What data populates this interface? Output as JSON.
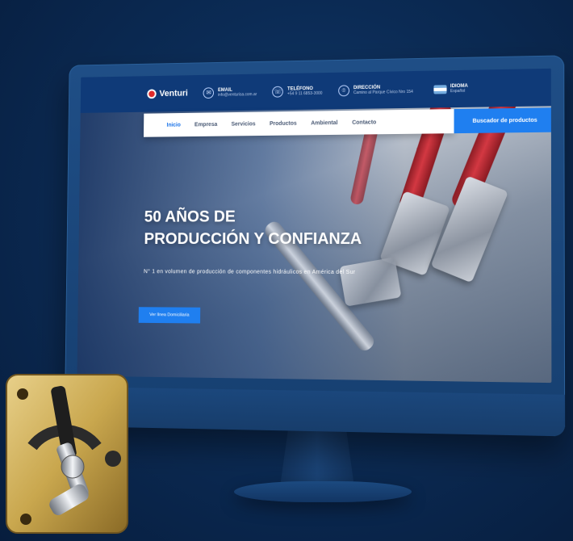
{
  "site": {
    "logo_text": "Venturi",
    "header_info": [
      {
        "label": "EMAIL",
        "value": "info@venturisa.com.ar",
        "icon": "email-icon"
      },
      {
        "label": "TELÉFONO",
        "value": "+54 9 11 6853-3000",
        "icon": "phone-icon"
      },
      {
        "label": "DIRECCIÓN",
        "value": "Camino al Parque Cívico Nro 154",
        "icon": "location-icon"
      }
    ],
    "language": {
      "label": "IDIOMA",
      "value": "Español"
    },
    "nav": [
      "Inicio",
      "Empresa",
      "Servicios",
      "Productos",
      "Ambiental",
      "Contacto"
    ],
    "nav_cta": "Buscador de productos",
    "hero": {
      "title_line1": "50 AÑOS DE",
      "title_line2": "PRODUCCIÓN Y CONFIANZA",
      "subtitle": "N° 1 en volumen de producción de componentes hidráulicos en América del Sur",
      "button": "Ver línea Domiciliaria"
    }
  },
  "colors": {
    "background": "#0b2b55",
    "header": "#0f3a78",
    "accent": "#1f7ff0",
    "brand_red": "#e02b2b"
  }
}
